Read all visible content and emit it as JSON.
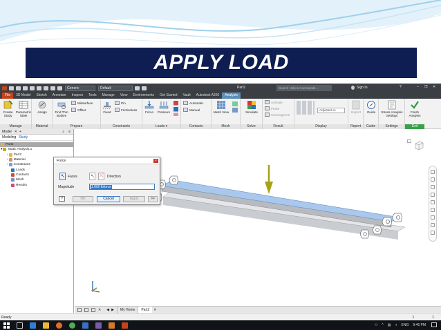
{
  "slide": {
    "title": "APPLY LOAD"
  },
  "qat": {
    "appearance": "Generic",
    "material": "Default",
    "doc_title": "Part2",
    "search_placeholder": "Search Help & Commands...",
    "signin": "Sign In"
  },
  "tabs": [
    "File",
    "3D Model",
    "Sketch",
    "Annotate",
    "Inspect",
    "Tools",
    "Manage",
    "View",
    "Environments",
    "Get Started",
    "Vault",
    "Autodesk A360",
    "Analysis"
  ],
  "ribbon": {
    "manage": {
      "label": "Manage",
      "create_study": "Create Study",
      "parametric_table": "Parametric Table"
    },
    "material": {
      "label": "Material",
      "assign": "Assign"
    },
    "prepare": {
      "label": "Prepare",
      "find_thin_bodies": "Find Thin Bodies",
      "midsurface": "Midsurface",
      "offset": "Offset"
    },
    "constraints": {
      "label": "Constraints",
      "fixed": "Fixed",
      "pin": "Pin",
      "frictionless": "Frictionless"
    },
    "loads": {
      "label": "Loads",
      "force": "Force",
      "pressure": "Pressure"
    },
    "contacts": {
      "label": "Contacts",
      "automatic": "Automatic",
      "manual": "Manual"
    },
    "mesh": {
      "label": "Mesh",
      "mesh_view": "Mesh View"
    },
    "solve": {
      "label": "Solve",
      "simulate": "Simulate"
    },
    "result": {
      "label": "Result",
      "animate": "Animate",
      "probe": "Probe",
      "convergence": "Convergence"
    },
    "display": {
      "label": "Display",
      "adjusted": "Adjusted x1"
    },
    "report": {
      "label": "Report",
      "report": "Report"
    },
    "guide": {
      "label": "Guide",
      "guide": "Guide"
    },
    "settings": {
      "label": "Settings",
      "stress_settings": "Stress Analysis Settings"
    },
    "exit": {
      "label": "Exit",
      "finish": "Finish Analysis"
    }
  },
  "model_panel": {
    "title": "Model",
    "tab_modeling": "Modeling",
    "tab_study": "Study",
    "tree": [
      "Part2",
      "Static Analysis:1",
      "Part2",
      "Material",
      "Constraints",
      "Loads",
      "Contacts",
      "Mesh",
      "Results"
    ]
  },
  "dialog": {
    "title": "Force",
    "faces": "Faces",
    "direction": "Direction",
    "magnitude_label": "Magnitude",
    "magnitude_value": "1.000 lbforce",
    "ok": "OK",
    "cancel": "Cancel",
    "apply": "Apply",
    "more": ">>"
  },
  "doc_tabs": [
    "My Home",
    "Part2"
  ],
  "status": {
    "text": "Ready",
    "n1": "1",
    "n2": "1"
  },
  "taskbar": {
    "lang": "ENG",
    "time": "9:46 PM"
  },
  "colors": {
    "banner": "#0e1d52",
    "file_tab": "#c4431c",
    "analysis_tab": "#5b8fb9",
    "beam_top": "#a9c8ec",
    "arrow": "#a8a215"
  }
}
